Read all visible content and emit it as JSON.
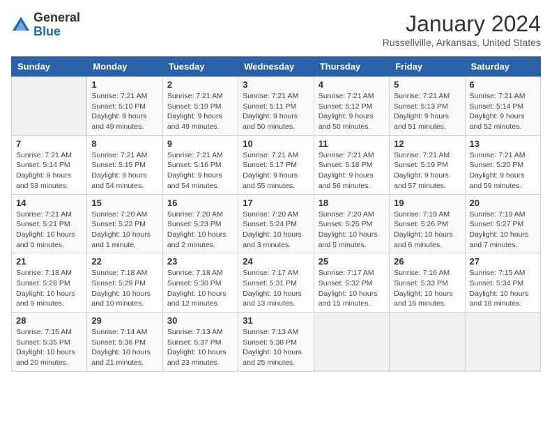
{
  "logo": {
    "general": "General",
    "blue": "Blue"
  },
  "header": {
    "month": "January 2024",
    "location": "Russellville, Arkansas, United States"
  },
  "weekdays": [
    "Sunday",
    "Monday",
    "Tuesday",
    "Wednesday",
    "Thursday",
    "Friday",
    "Saturday"
  ],
  "weeks": [
    [
      {
        "day": "",
        "info": ""
      },
      {
        "day": "1",
        "info": "Sunrise: 7:21 AM\nSunset: 5:10 PM\nDaylight: 9 hours\nand 49 minutes."
      },
      {
        "day": "2",
        "info": "Sunrise: 7:21 AM\nSunset: 5:10 PM\nDaylight: 9 hours\nand 49 minutes."
      },
      {
        "day": "3",
        "info": "Sunrise: 7:21 AM\nSunset: 5:11 PM\nDaylight: 9 hours\nand 50 minutes."
      },
      {
        "day": "4",
        "info": "Sunrise: 7:21 AM\nSunset: 5:12 PM\nDaylight: 9 hours\nand 50 minutes."
      },
      {
        "day": "5",
        "info": "Sunrise: 7:21 AM\nSunset: 5:13 PM\nDaylight: 9 hours\nand 51 minutes."
      },
      {
        "day": "6",
        "info": "Sunrise: 7:21 AM\nSunset: 5:14 PM\nDaylight: 9 hours\nand 52 minutes."
      }
    ],
    [
      {
        "day": "7",
        "info": "Sunrise: 7:21 AM\nSunset: 5:14 PM\nDaylight: 9 hours\nand 53 minutes."
      },
      {
        "day": "8",
        "info": "Sunrise: 7:21 AM\nSunset: 5:15 PM\nDaylight: 9 hours\nand 54 minutes."
      },
      {
        "day": "9",
        "info": "Sunrise: 7:21 AM\nSunset: 5:16 PM\nDaylight: 9 hours\nand 54 minutes."
      },
      {
        "day": "10",
        "info": "Sunrise: 7:21 AM\nSunset: 5:17 PM\nDaylight: 9 hours\nand 55 minutes."
      },
      {
        "day": "11",
        "info": "Sunrise: 7:21 AM\nSunset: 5:18 PM\nDaylight: 9 hours\nand 56 minutes."
      },
      {
        "day": "12",
        "info": "Sunrise: 7:21 AM\nSunset: 5:19 PM\nDaylight: 9 hours\nand 57 minutes."
      },
      {
        "day": "13",
        "info": "Sunrise: 7:21 AM\nSunset: 5:20 PM\nDaylight: 9 hours\nand 59 minutes."
      }
    ],
    [
      {
        "day": "14",
        "info": "Sunrise: 7:21 AM\nSunset: 5:21 PM\nDaylight: 10 hours\nand 0 minutes."
      },
      {
        "day": "15",
        "info": "Sunrise: 7:20 AM\nSunset: 5:22 PM\nDaylight: 10 hours\nand 1 minute."
      },
      {
        "day": "16",
        "info": "Sunrise: 7:20 AM\nSunset: 5:23 PM\nDaylight: 10 hours\nand 2 minutes."
      },
      {
        "day": "17",
        "info": "Sunrise: 7:20 AM\nSunset: 5:24 PM\nDaylight: 10 hours\nand 3 minutes."
      },
      {
        "day": "18",
        "info": "Sunrise: 7:20 AM\nSunset: 5:25 PM\nDaylight: 10 hours\nand 5 minutes."
      },
      {
        "day": "19",
        "info": "Sunrise: 7:19 AM\nSunset: 5:26 PM\nDaylight: 10 hours\nand 6 minutes."
      },
      {
        "day": "20",
        "info": "Sunrise: 7:19 AM\nSunset: 5:27 PM\nDaylight: 10 hours\nand 7 minutes."
      }
    ],
    [
      {
        "day": "21",
        "info": "Sunrise: 7:18 AM\nSunset: 5:28 PM\nDaylight: 10 hours\nand 9 minutes."
      },
      {
        "day": "22",
        "info": "Sunrise: 7:18 AM\nSunset: 5:29 PM\nDaylight: 10 hours\nand 10 minutes."
      },
      {
        "day": "23",
        "info": "Sunrise: 7:18 AM\nSunset: 5:30 PM\nDaylight: 10 hours\nand 12 minutes."
      },
      {
        "day": "24",
        "info": "Sunrise: 7:17 AM\nSunset: 5:31 PM\nDaylight: 10 hours\nand 13 minutes."
      },
      {
        "day": "25",
        "info": "Sunrise: 7:17 AM\nSunset: 5:32 PM\nDaylight: 10 hours\nand 15 minutes."
      },
      {
        "day": "26",
        "info": "Sunrise: 7:16 AM\nSunset: 5:33 PM\nDaylight: 10 hours\nand 16 minutes."
      },
      {
        "day": "27",
        "info": "Sunrise: 7:15 AM\nSunset: 5:34 PM\nDaylight: 10 hours\nand 18 minutes."
      }
    ],
    [
      {
        "day": "28",
        "info": "Sunrise: 7:15 AM\nSunset: 5:35 PM\nDaylight: 10 hours\nand 20 minutes."
      },
      {
        "day": "29",
        "info": "Sunrise: 7:14 AM\nSunset: 5:36 PM\nDaylight: 10 hours\nand 21 minutes."
      },
      {
        "day": "30",
        "info": "Sunrise: 7:13 AM\nSunset: 5:37 PM\nDaylight: 10 hours\nand 23 minutes."
      },
      {
        "day": "31",
        "info": "Sunrise: 7:13 AM\nSunset: 5:38 PM\nDaylight: 10 hours\nand 25 minutes."
      },
      {
        "day": "",
        "info": ""
      },
      {
        "day": "",
        "info": ""
      },
      {
        "day": "",
        "info": ""
      }
    ]
  ]
}
